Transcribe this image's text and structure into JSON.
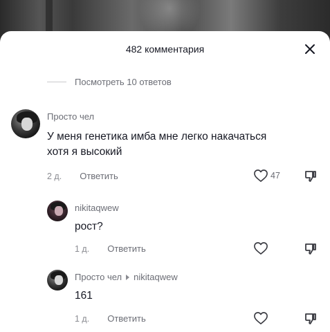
{
  "header": {
    "title": "482 комментария",
    "close_icon": "close-icon"
  },
  "view_replies": {
    "label": "Посмотреть 10 ответов"
  },
  "comments": [
    {
      "username": "Просто чел",
      "text_lines": [
        "У меня генетика имба мне легко накачаться",
        "хотя я высокий"
      ],
      "time": "2 д.",
      "reply_label": "Ответить",
      "likes": "47"
    },
    {
      "username": "nikitaqwew",
      "text_lines": [
        "рост?"
      ],
      "time": "1 д.",
      "reply_label": "Ответить"
    },
    {
      "username": "Просто чел",
      "reply_to": "nikitaqwew",
      "text_lines": [
        "161"
      ],
      "time": "1 д.",
      "reply_label": "Ответить"
    }
  ],
  "colors": {
    "text": "#161823",
    "secondary": "#6b6d75",
    "muted": "#8a8b91"
  }
}
